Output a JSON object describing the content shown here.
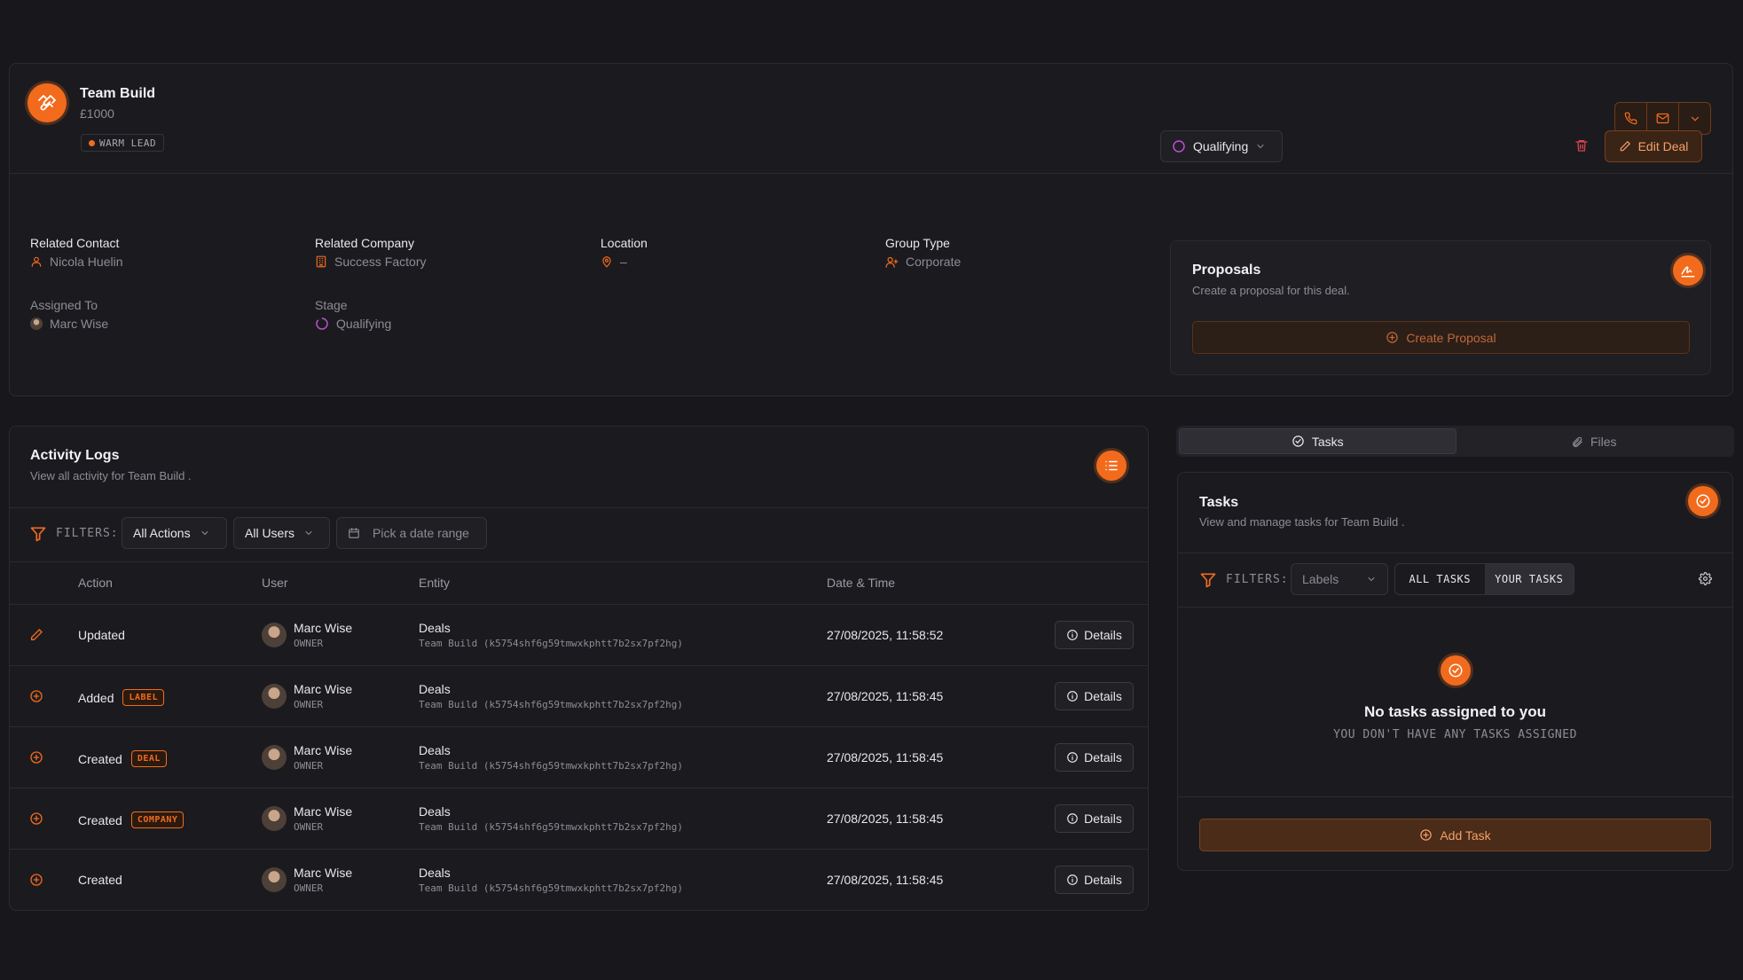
{
  "deal": {
    "title": "Team Build",
    "amount": "£1000",
    "badge": "WARM LEAD"
  },
  "fields": {
    "related_contact": {
      "label": "Related Contact",
      "value": "Nicola Huelin"
    },
    "related_company": {
      "label": "Related Company",
      "value": "Success Factory"
    },
    "location": {
      "label": "Location",
      "value": "–"
    },
    "group_type": {
      "label": "Group Type",
      "value": "Corporate"
    },
    "assigned_to": {
      "label": "Assigned To",
      "value": "Marc Wise"
    },
    "stage": {
      "label": "Stage",
      "value": "Qualifying"
    }
  },
  "toolbar": {
    "stage_select": "Qualifying",
    "edit_deal": "Edit Deal"
  },
  "proposals": {
    "title": "Proposals",
    "subtitle": "Create a proposal for this deal.",
    "button": "Create Proposal"
  },
  "activity": {
    "title": "Activity Logs",
    "subtitle": "View all activity for Team Build .",
    "filters_label": "FILTERS:",
    "actions_filter": "All Actions",
    "users_filter": "All Users",
    "date_placeholder": "Pick a date range",
    "columns": [
      "Action",
      "User",
      "Entity",
      "Date & Time"
    ],
    "rows": [
      {
        "action": "Updated",
        "tag": "",
        "user": "Marc Wise",
        "role": "OWNER",
        "entity": "Deals",
        "entity_id": "Team Build (k5754shf6g59tmwxkphtt7b2sx7pf2hg)",
        "date": "27/08/2025, 11:58:52",
        "details": "Details"
      },
      {
        "action": "Added",
        "tag": "LABEL",
        "user": "Marc Wise",
        "role": "OWNER",
        "entity": "Deals",
        "entity_id": "Team Build (k5754shf6g59tmwxkphtt7b2sx7pf2hg)",
        "date": "27/08/2025, 11:58:45",
        "details": "Details"
      },
      {
        "action": "Created",
        "tag": "DEAL",
        "user": "Marc Wise",
        "role": "OWNER",
        "entity": "Deals",
        "entity_id": "Team Build (k5754shf6g59tmwxkphtt7b2sx7pf2hg)",
        "date": "27/08/2025, 11:58:45",
        "details": "Details"
      },
      {
        "action": "Created",
        "tag": "COMPANY",
        "user": "Marc Wise",
        "role": "OWNER",
        "entity": "Deals",
        "entity_id": "Team Build (k5754shf6g59tmwxkphtt7b2sx7pf2hg)",
        "date": "27/08/2025, 11:58:45",
        "details": "Details"
      },
      {
        "action": "Created",
        "tag": "",
        "user": "Marc Wise",
        "role": "OWNER",
        "entity": "Deals",
        "entity_id": "Team Build (k5754shf6g59tmwxkphtt7b2sx7pf2hg)",
        "date": "27/08/2025, 11:58:45",
        "details": "Details"
      }
    ]
  },
  "tabs": {
    "tasks": "Tasks",
    "files": "Files"
  },
  "tasks": {
    "title": "Tasks",
    "subtitle": "View and manage tasks for Team Build .",
    "filters_label": "FILTERS:",
    "labels_filter": "Labels",
    "all_tasks": "ALL TASKS",
    "your_tasks": "YOUR TASKS",
    "empty_title": "No tasks assigned to you",
    "empty_sub": "YOU DON'T HAVE ANY TASKS ASSIGNED",
    "add_task": "Add Task"
  },
  "colors": {
    "accent": "#f26b1d",
    "stage": "#c04fd6",
    "background": "#18181c"
  }
}
